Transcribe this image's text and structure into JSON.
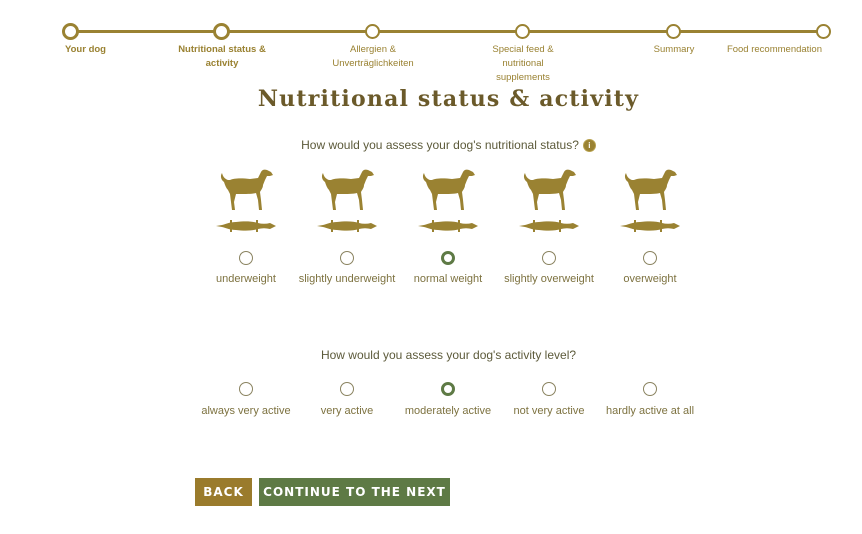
{
  "stepper": {
    "steps": [
      {
        "label": "Your dog",
        "state": "done"
      },
      {
        "label": "Nutritional status & activity",
        "state": "active"
      },
      {
        "label": "Allergien & Unverträglichkeiten",
        "state": "todo"
      },
      {
        "label": "Special feed & nutritional supplements",
        "state": "todo"
      },
      {
        "label": "Summary",
        "state": "todo"
      },
      {
        "label": "Food recommendation",
        "state": "todo"
      }
    ]
  },
  "page_title": "Nutritional status & activity",
  "nutrition": {
    "question": "How would you assess your dog's nutritional status?",
    "info_icon": "info-icon",
    "options": [
      {
        "label": "underweight",
        "checked": false
      },
      {
        "label": "slightly underweight",
        "checked": false
      },
      {
        "label": "normal weight",
        "checked": true
      },
      {
        "label": "slightly overweight",
        "checked": false
      },
      {
        "label": "overweight",
        "checked": false
      }
    ]
  },
  "activity": {
    "question": "How would you assess your dog's activity level?",
    "options": [
      {
        "label": "always very active",
        "checked": false
      },
      {
        "label": "very active",
        "checked": false
      },
      {
        "label": "moderately active",
        "checked": true
      },
      {
        "label": "not very active",
        "checked": false
      },
      {
        "label": "hardly active at all",
        "checked": false
      }
    ]
  },
  "buttons": {
    "back": "BACK",
    "next": "CONTINUE TO THE NEXT STEP"
  },
  "colors": {
    "accent_gold": "#9a8232",
    "accent_green": "#5e7a45",
    "title_brown": "#6b5a2a"
  }
}
